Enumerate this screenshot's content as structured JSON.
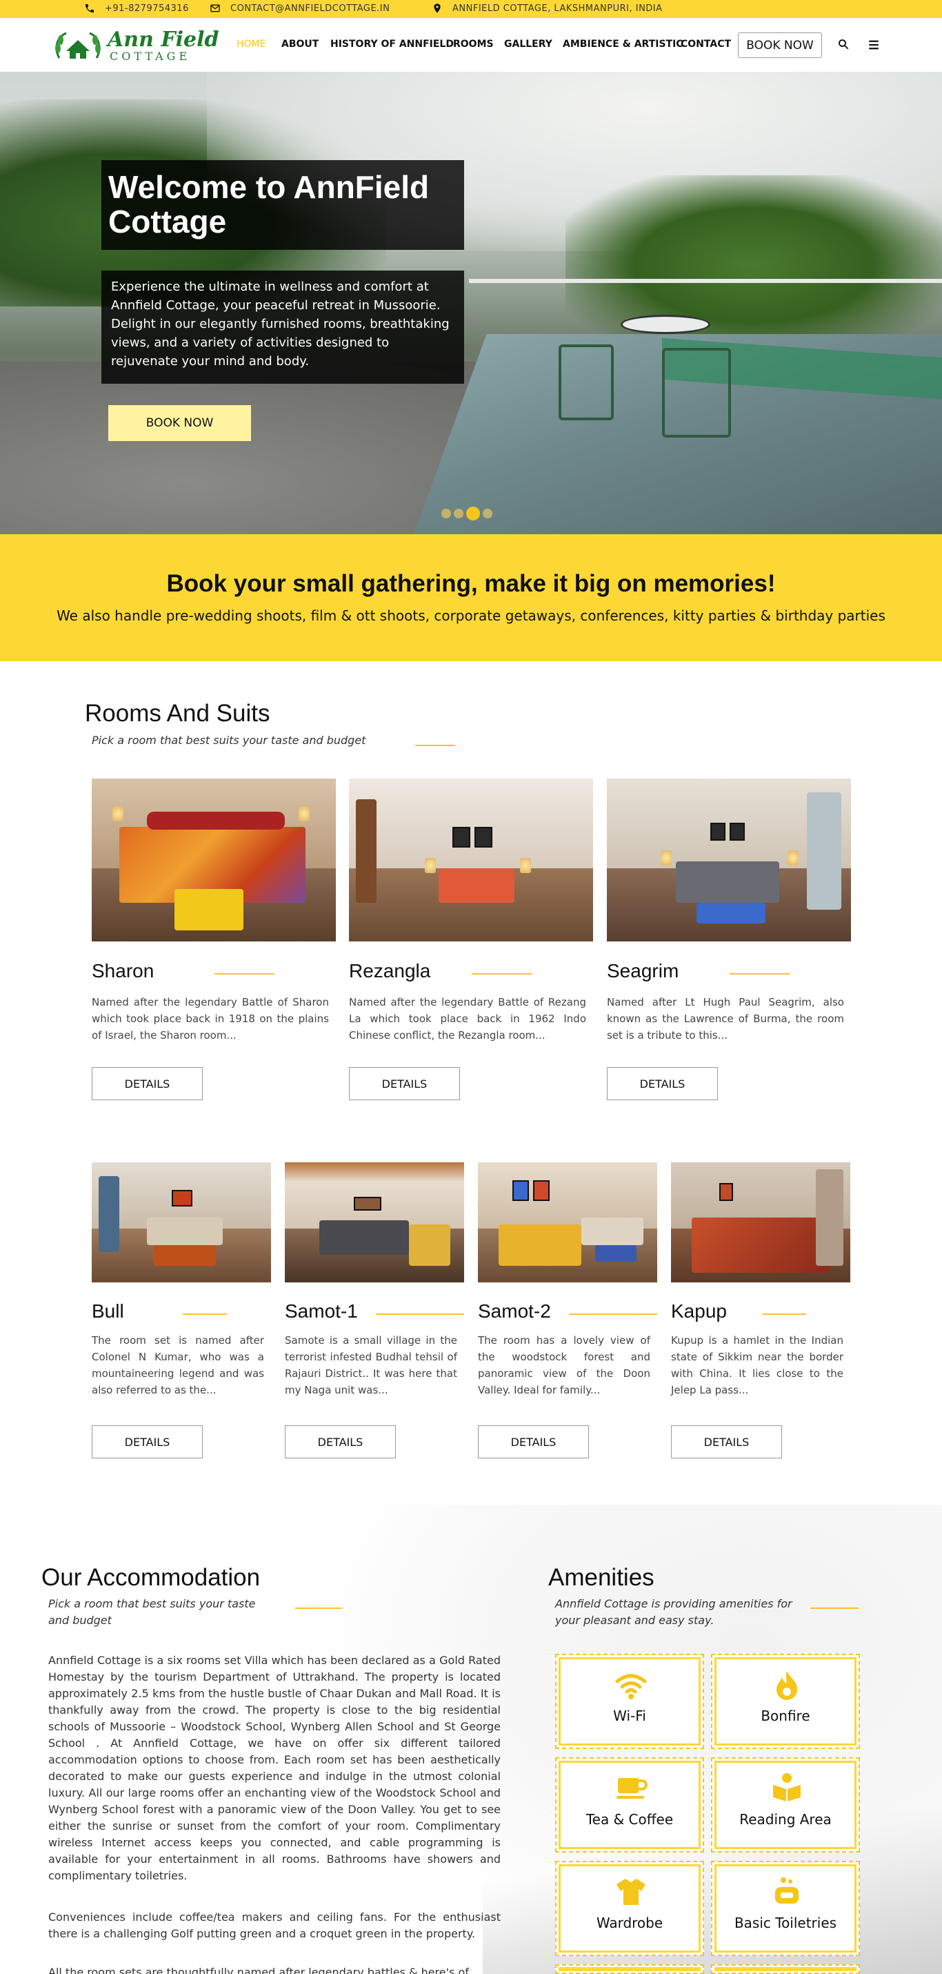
{
  "topbar": {
    "phone": "+91-8279754316",
    "email": "CONTACT@ANNFIELDCOTTAGE.IN",
    "address": "ANNFIELD COTTAGE, LAKSHMANPURI, INDIA"
  },
  "logo": {
    "line1": "Ann Field",
    "line2": "COTTAGE"
  },
  "nav": {
    "items": [
      "HOME",
      "ABOUT",
      "HISTORY OF ANNFIELD",
      "ROOMS",
      "GALLERY",
      "AMBIENCE & ARTISTIC",
      "CONTACT"
    ],
    "book": "BOOK NOW"
  },
  "hero": {
    "title": "Welcome to AnnField Cottage",
    "text": "Experience the ultimate in wellness and comfort at Annfield Cottage, your peaceful retreat in Mussoorie. Delight in our elegantly furnished rooms, breathtaking views, and a variety of activities designed to rejuvenate your mind and body.",
    "button": "BOOK NOW"
  },
  "band": {
    "title": "Book your small gathering, make it big on memories!",
    "text": "We also handle pre-wedding shoots, film & ott shoots, corporate getaways, conferences, kitty parties & birthday parties"
  },
  "rooms": {
    "title": "Rooms And Suits",
    "subtitle": "Pick a room that best suits your taste and budget",
    "details_label": "DETAILS",
    "row1": [
      {
        "name": "Sharon",
        "desc": "Named after the legendary Battle of Sharon which took place back in 1918 on the plains of Israel, the Sharon room..."
      },
      {
        "name": "Rezangla",
        "desc": "Named after the legendary Battle of Rezang La which took place back in 1962 Indo Chinese conflict, the Rezangla room..."
      },
      {
        "name": "Seagrim",
        "desc": "Named after Lt Hugh Paul Seagrim, also known as the Lawrence of Burma, the room set is a tribute to this..."
      }
    ],
    "row2": [
      {
        "name": "Bull",
        "desc": "The room set is named after Colonel N Kumar, who was a mountaineering legend and was also referred to as the..."
      },
      {
        "name": "Samot-1",
        "desc": "Samote is a small village in the terrorist infested Budhal tehsil of Rajauri District.. It was here that my Naga unit was..."
      },
      {
        "name": "Samot-2",
        "desc": "The room has a lovely view of the woodstock forest and panoramic view of the Doon Valley. Ideal for family..."
      },
      {
        "name": "Kapup",
        "desc": "Kupup is a hamlet in the Indian state of Sikkim near the border with China. It lies close to the Jelep La pass..."
      }
    ]
  },
  "accommodation": {
    "title": "Our Accommodation",
    "subtitle": "Pick a room that best suits your taste and budget",
    "p1": "Annfield Cottage is a six rooms set Villa which has been declared as a Gold Rated Homestay by the tourism Department of Uttrakhand. The property is located approximately 2.5 kms from the hustle bustle of Chaar Dukan and Mall Road. It is thankfully away from the crowd. The property is close to the big residential schools of Mussoorie – Woodstock School, Wynberg Allen School and St George School . At Annfield Cottage, we have on offer six different tailored accommodation options to choose from. Each room set has been aesthetically decorated to make our guests experience and indulge in the utmost colonial luxury. All our large rooms offer an enchanting view of the Woodstock School and Wynberg School forest with a panoramic view of the Doon Valley. You get to see either the sunrise or sunset from the comfort of your room. Complimentary wireless Internet access keeps you connected, and cable programming is available for your entertainment in all rooms. Bathrooms have showers and complimentary toiletries.",
    "p2": "Conveniences include coffee/tea makers and ceiling fans. For the enthusiast there is a challenging Golf putting green and a croquet green in the property.",
    "p3": "All the room sets are thoughtfully named after legendary battles & here's of"
  },
  "amenities": {
    "title": "Amenities",
    "subtitle": "Annfield Cottage is providing amenities for your pleasant and easy stay.",
    "items": [
      {
        "label": "Wi-Fi",
        "icon": "wifi-icon"
      },
      {
        "label": "Bonfire",
        "icon": "fire-icon"
      },
      {
        "label": "Tea & Coffee",
        "icon": "coffee-cup-icon"
      },
      {
        "label": "Reading Area",
        "icon": "book-reader-icon"
      },
      {
        "label": "Wardrobe",
        "icon": "shirt-icon"
      },
      {
        "label": "Basic Toiletries",
        "icon": "toiletries-icon"
      }
    ]
  },
  "colors": {
    "accent": "#fdd835",
    "brand_green": "#1e7a2c"
  }
}
